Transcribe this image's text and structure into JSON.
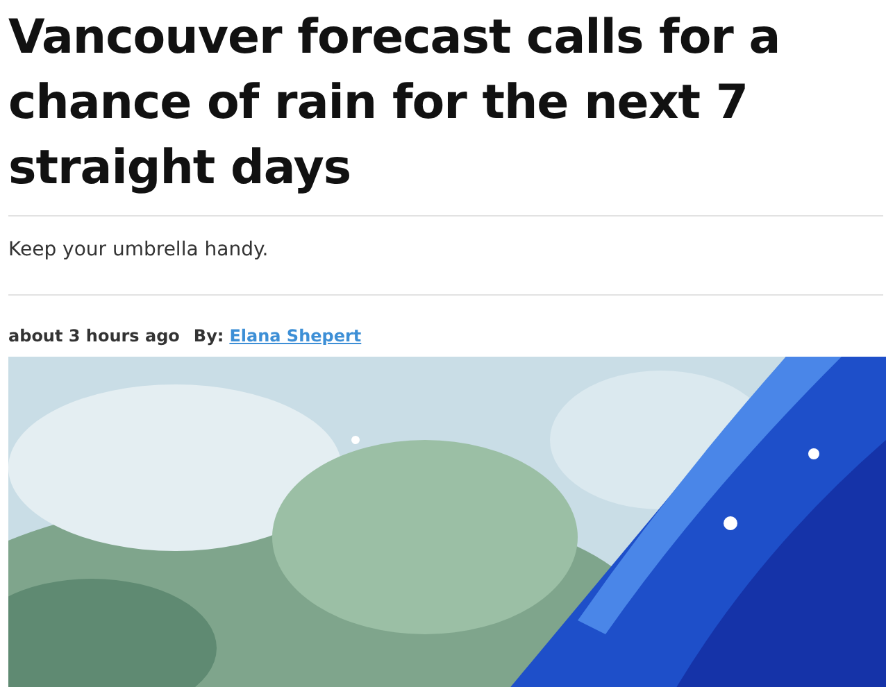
{
  "article": {
    "headline": "Vancouver forecast calls for a chance of rain for the next 7 straight days",
    "subhead": "Keep your umbrella handy.",
    "time": "about 3 hours ago",
    "by_label": "By:",
    "author": "Elana Shepert"
  }
}
